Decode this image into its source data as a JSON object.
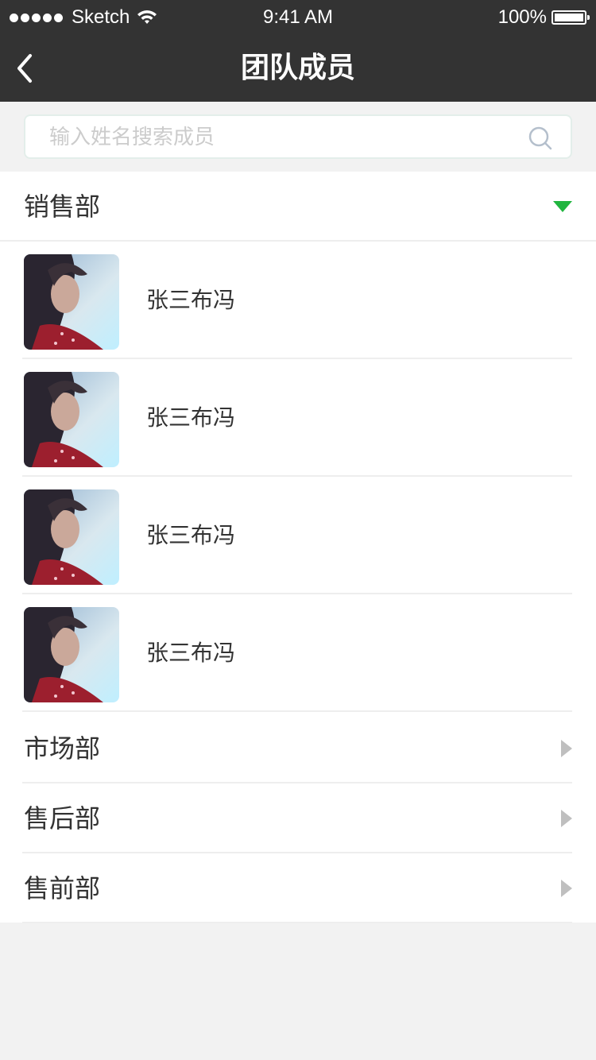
{
  "status_bar": {
    "carrier": "Sketch",
    "time": "9:41 AM",
    "battery": "100%"
  },
  "nav": {
    "title": "团队成员",
    "back_icon": "chevron-left-icon"
  },
  "search": {
    "placeholder": "输入姓名搜索成员",
    "value": "",
    "icon": "search-icon"
  },
  "groups": {
    "open": {
      "label": "销售部",
      "icon": "caret-down-icon",
      "icon_color": "#21b53f",
      "members": [
        {
          "name": "张三布冯"
        },
        {
          "name": "张三布冯"
        },
        {
          "name": "张三布冯"
        },
        {
          "name": "张三布冯"
        }
      ]
    },
    "closed": [
      {
        "label": "市场部",
        "icon": "caret-right-icon"
      },
      {
        "label": "售后部",
        "icon": "caret-right-icon"
      },
      {
        "label": "售前部",
        "icon": "caret-right-icon"
      }
    ]
  },
  "colors": {
    "header_bg": "#333333",
    "page_bg": "#f2f2f2",
    "accent": "#21b53f",
    "caret_gray": "#bfbfbf"
  }
}
